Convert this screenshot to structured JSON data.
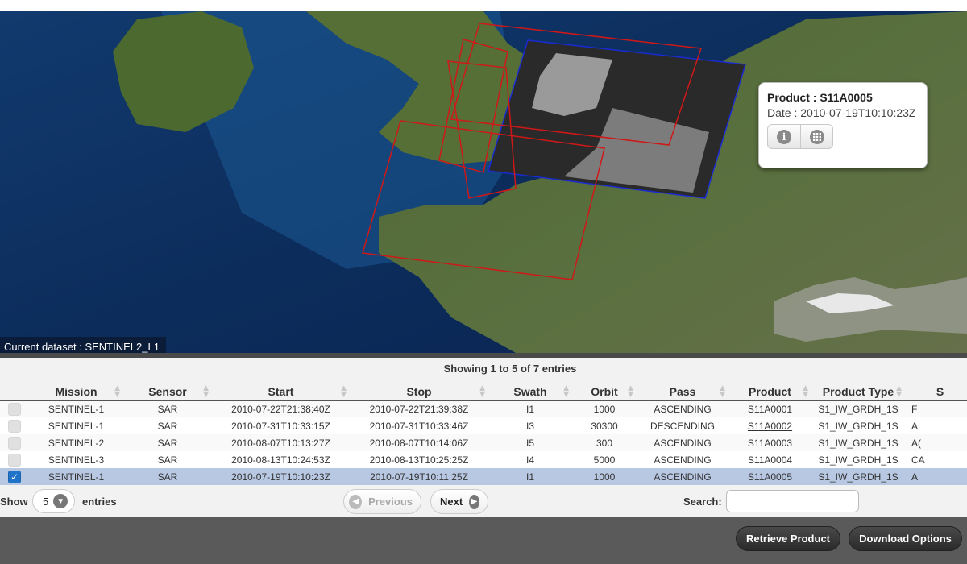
{
  "map": {
    "dataset_label": "Current dataset : SENTINEL2_L1",
    "popup": {
      "product_label": "Product : ",
      "product_id": "S11A0005",
      "date": "Date : 2010-07-19T10:10:23Z",
      "info_icon": "info-icon",
      "browse_icon": "grid-icon"
    }
  },
  "grid": {
    "summary": "Showing 1 to 5 of 7 entries",
    "columns": [
      "",
      "Mission",
      "Sensor",
      "Start",
      "Stop",
      "Swath",
      "Orbit",
      "Pass",
      "Product",
      "Product Type",
      "S"
    ],
    "rows": [
      {
        "checked": false,
        "mission": "SENTINEL-1",
        "sensor": "SAR",
        "start": "2010-07-22T21:38:40Z",
        "stop": "2010-07-22T21:39:38Z",
        "swath": "I1",
        "orbit": "1000",
        "pass": "ASCENDING",
        "product": "S11A0001",
        "product_type": "S1_IW_GRDH_1S",
        "extra": "F"
      },
      {
        "checked": false,
        "mission": "SENTINEL-1",
        "sensor": "SAR",
        "start": "2010-07-31T10:33:15Z",
        "stop": "2010-07-31T10:33:46Z",
        "swath": "I3",
        "orbit": "30300",
        "pass": "DESCENDING",
        "product": "S11A0002",
        "product_type": "S1_IW_GRDH_1S",
        "extra": "A"
      },
      {
        "checked": false,
        "mission": "SENTINEL-2",
        "sensor": "SAR",
        "start": "2010-08-07T10:13:27Z",
        "stop": "2010-08-07T10:14:06Z",
        "swath": "I5",
        "orbit": "300",
        "pass": "ASCENDING",
        "product": "S11A0003",
        "product_type": "S1_IW_GRDH_1S",
        "extra": "A("
      },
      {
        "checked": false,
        "mission": "SENTINEL-3",
        "sensor": "SAR",
        "start": "2010-08-13T10:24:53Z",
        "stop": "2010-08-13T10:25:25Z",
        "swath": "I4",
        "orbit": "5000",
        "pass": "ASCENDING",
        "product": "S11A0004",
        "product_type": "S1_IW_GRDH_1S",
        "extra": "CA"
      },
      {
        "checked": true,
        "mission": "SENTINEL-1",
        "sensor": "SAR",
        "start": "2010-07-19T10:10:23Z",
        "stop": "2010-07-19T10:11:25Z",
        "swath": "I1",
        "orbit": "1000",
        "pass": "ASCENDING",
        "product": "S11A0005",
        "product_type": "S1_IW_GRDH_1S",
        "extra": "A"
      }
    ],
    "show_label": "Show",
    "page_length": "5",
    "entries_label": "entries",
    "previous_label": "Previous",
    "next_label": "Next",
    "search_label": "Search:",
    "search_value": ""
  },
  "footer": {
    "retrieve_label": "Retrieve Product",
    "download_label": "Download Options"
  }
}
